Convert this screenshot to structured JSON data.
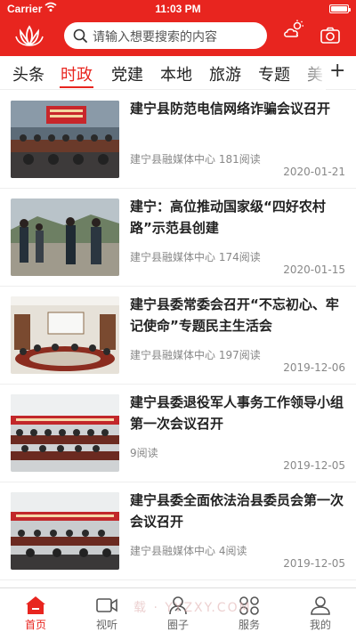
{
  "status_bar": {
    "carrier": "Carrier",
    "time": "11:03 PM"
  },
  "header": {
    "search_placeholder": "请输入想要搜索的内容",
    "logo_icon": "lotus-logo-icon",
    "weather_icon": "weather-cloud-icon",
    "camera_icon": "camera-icon"
  },
  "tabs": [
    {
      "label": "头条"
    },
    {
      "label": "时政"
    },
    {
      "label": "党建"
    },
    {
      "label": "本地"
    },
    {
      "label": "旅游"
    },
    {
      "label": "专题"
    },
    {
      "label": "美"
    }
  ],
  "active_tab": "时政",
  "tab_more": "+",
  "news": [
    {
      "title": "建宁县防范电信网络诈骗会议召开",
      "source": "建宁县融媒体中心 181阅读",
      "date": "2020-01-21"
    },
    {
      "title": "建宁：高位推动国家级“四好农村路”示范县创建",
      "source": "建宁县融媒体中心 174阅读",
      "date": "2020-01-15"
    },
    {
      "title": "建宁县委常委会召开“不忘初心、牢记使命”专题民主生活会",
      "source": "建宁县融媒体中心 197阅读",
      "date": "2019-12-06"
    },
    {
      "title": "建宁县委退役军人事务工作领导小组第一次会议召开",
      "source": "9阅读",
      "date": "2019-12-05"
    },
    {
      "title": "建宁县委全面依法治县委员会第一次会议召开",
      "source": "建宁县融媒体中心 4阅读",
      "date": "2019-12-05"
    }
  ],
  "bottom_tabs": [
    {
      "label": "首页",
      "icon": "home-icon"
    },
    {
      "label": "视听",
      "icon": "video-icon"
    },
    {
      "label": "圈子",
      "icon": "circle-icon"
    },
    {
      "label": "服务",
      "icon": "services-icon"
    },
    {
      "label": "我的",
      "icon": "profile-icon"
    }
  ],
  "watermark": "载 · YYZXY.COM",
  "colors": {
    "brand": "#e8251f",
    "text": "#222222",
    "meta": "#888888"
  }
}
